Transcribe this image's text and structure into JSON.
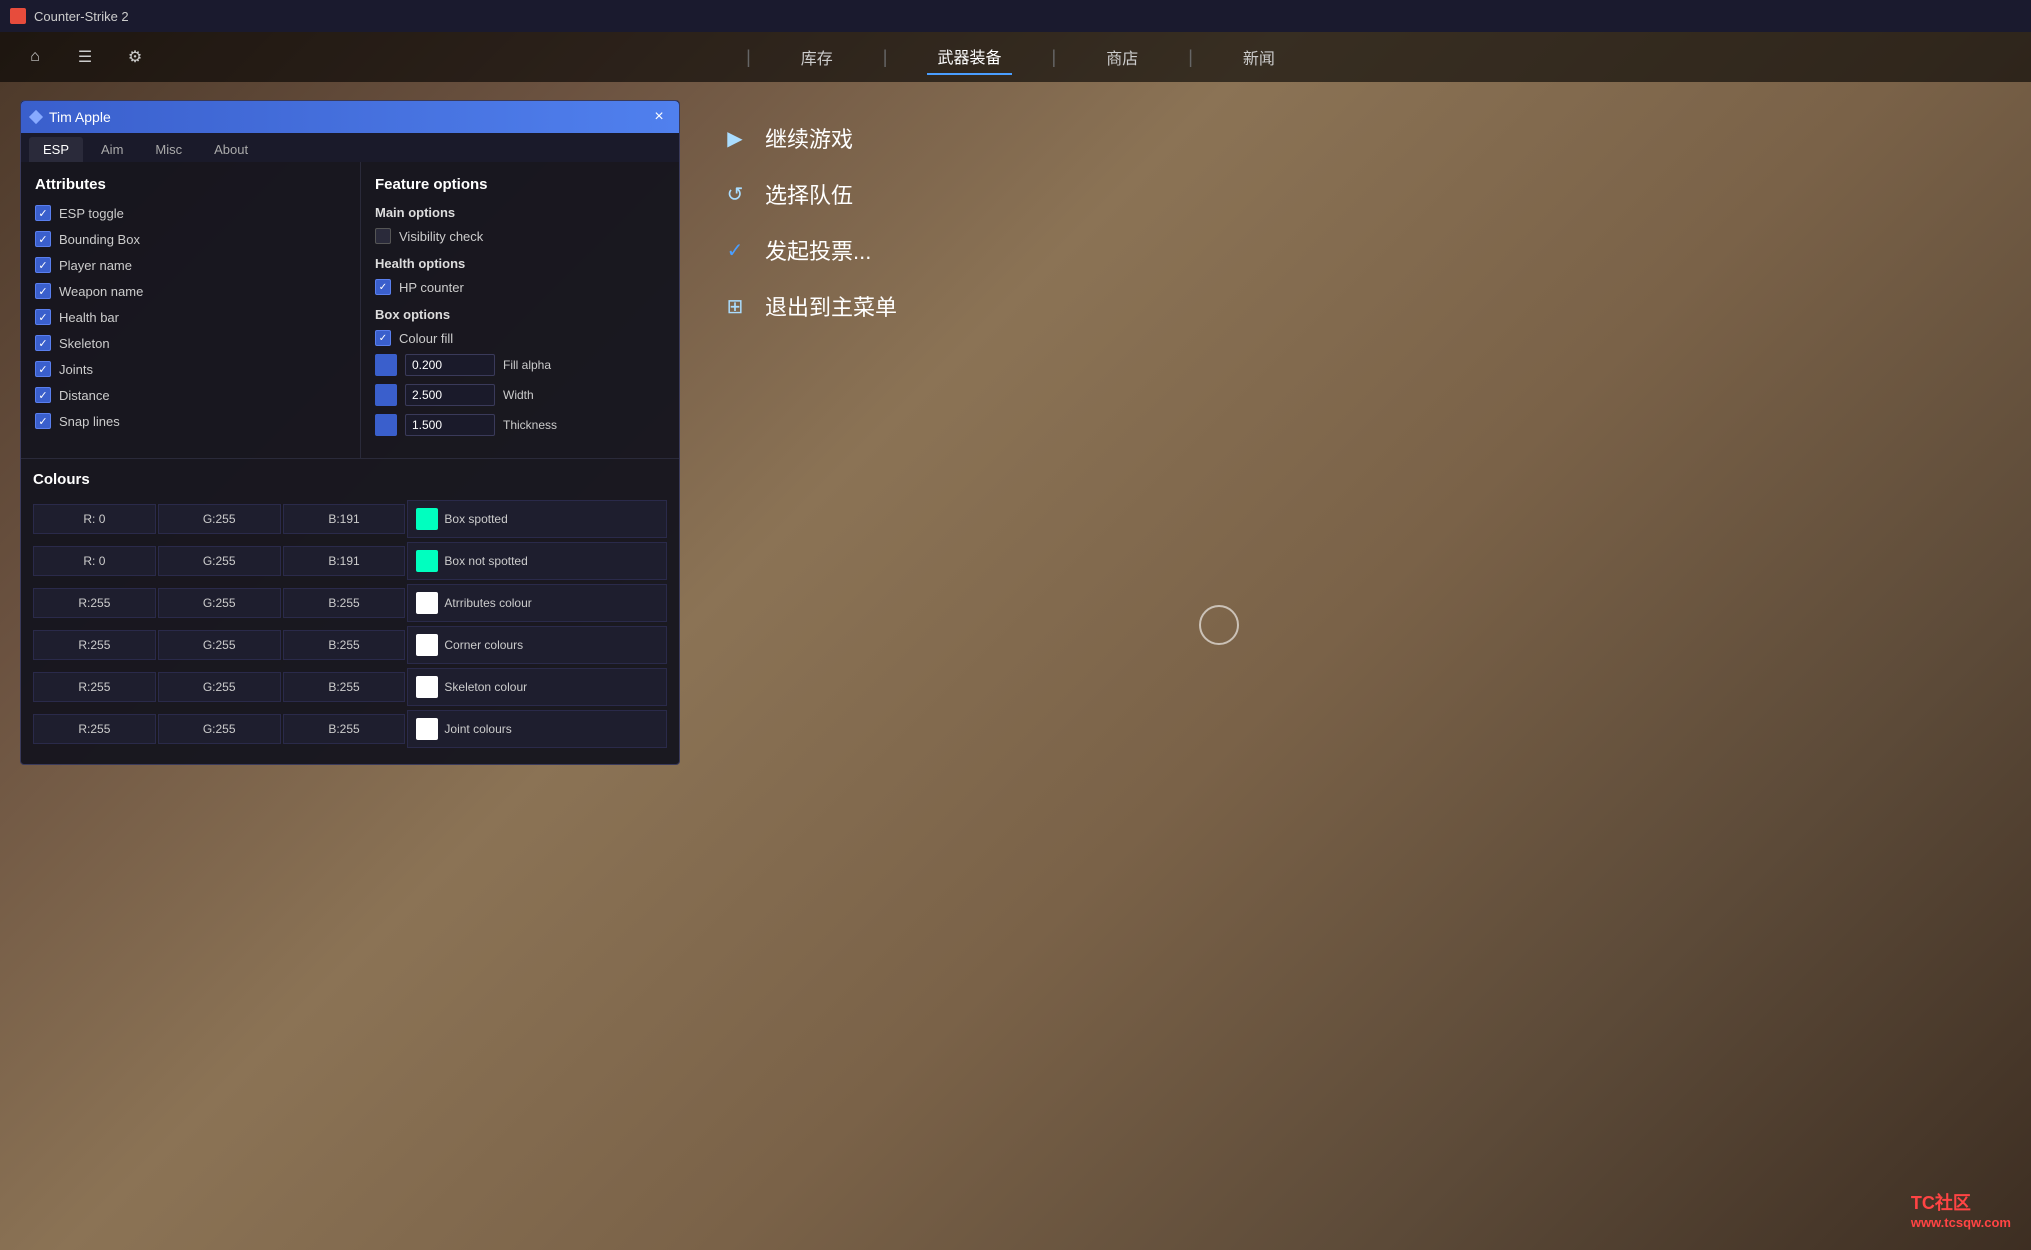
{
  "titlebar": {
    "title": "Counter-Strike 2"
  },
  "topnav": {
    "icons": [
      "home",
      "inventory",
      "settings"
    ],
    "items": [
      {
        "label": "库存",
        "active": false
      },
      {
        "label": "武器装备",
        "active": true
      },
      {
        "label": "商店",
        "active": false
      },
      {
        "label": "新闻",
        "active": false
      }
    ]
  },
  "espPanel": {
    "title": "Tim Apple",
    "closeLabel": "×",
    "tabs": [
      {
        "label": "ESP",
        "active": true
      },
      {
        "label": "Aim",
        "active": false
      },
      {
        "label": "Misc",
        "active": false
      },
      {
        "label": "About",
        "active": false
      }
    ],
    "attributes": {
      "title": "Attributes",
      "items": [
        {
          "label": "ESP toggle",
          "checked": true
        },
        {
          "label": "Bounding Box",
          "checked": true
        },
        {
          "label": "Player name",
          "checked": true
        },
        {
          "label": "Weapon name",
          "checked": true
        },
        {
          "label": "Health bar",
          "checked": true
        },
        {
          "label": "Skeleton",
          "checked": true
        },
        {
          "label": "Joints",
          "checked": true
        },
        {
          "label": "Distance",
          "checked": true
        },
        {
          "label": "Snap lines",
          "checked": true
        }
      ]
    },
    "featureOptions": {
      "title": "Feature options",
      "mainOptions": {
        "title": "Main options",
        "items": [
          {
            "label": "Visibility check",
            "checked": false
          }
        ]
      },
      "healthOptions": {
        "title": "Health options",
        "items": [
          {
            "label": "HP counter",
            "checked": true
          }
        ]
      },
      "boxOptions": {
        "title": "Box options",
        "items": [
          {
            "label": "Colour fill",
            "checked": true
          }
        ],
        "sliders": [
          {
            "value": "0.200",
            "label": "Fill alpha"
          },
          {
            "value": "2.500",
            "label": "Width"
          },
          {
            "value": "1.500",
            "label": "Thickness"
          }
        ]
      }
    },
    "colours": {
      "title": "Colours",
      "rows": [
        {
          "r": "R:  0",
          "g": "G:255",
          "b": "B:191",
          "swatch": "#00ffbf",
          "name": "Box spotted"
        },
        {
          "r": "R:  0",
          "g": "G:255",
          "b": "B:191",
          "swatch": "#00ffbf",
          "name": "Box not spotted"
        },
        {
          "r": "R:255",
          "g": "G:255",
          "b": "B:255",
          "swatch": "#ffffff",
          "name": "Atrributes colour"
        },
        {
          "r": "R:255",
          "g": "G:255",
          "b": "B:255",
          "swatch": "#ffffff",
          "name": "Corner colours"
        },
        {
          "r": "R:255",
          "g": "G:255",
          "b": "B:255",
          "swatch": "#ffffff",
          "name": "Skeleton colour"
        },
        {
          "r": "R:255",
          "g": "G:255",
          "b": "B:255",
          "swatch": "#ffffff",
          "name": "Joint colours"
        }
      ]
    }
  },
  "gameMenu": {
    "items": [
      {
        "icon": "▶",
        "label": "继续游戏"
      },
      {
        "icon": "↺",
        "label": "选择队伍"
      },
      {
        "icon": "✓",
        "label": "发起投票..."
      },
      {
        "icon": "⊞",
        "label": "退出到主菜单"
      }
    ]
  },
  "watermark": {
    "line1": "TC社区",
    "line2": "www.tcsqw.com"
  }
}
